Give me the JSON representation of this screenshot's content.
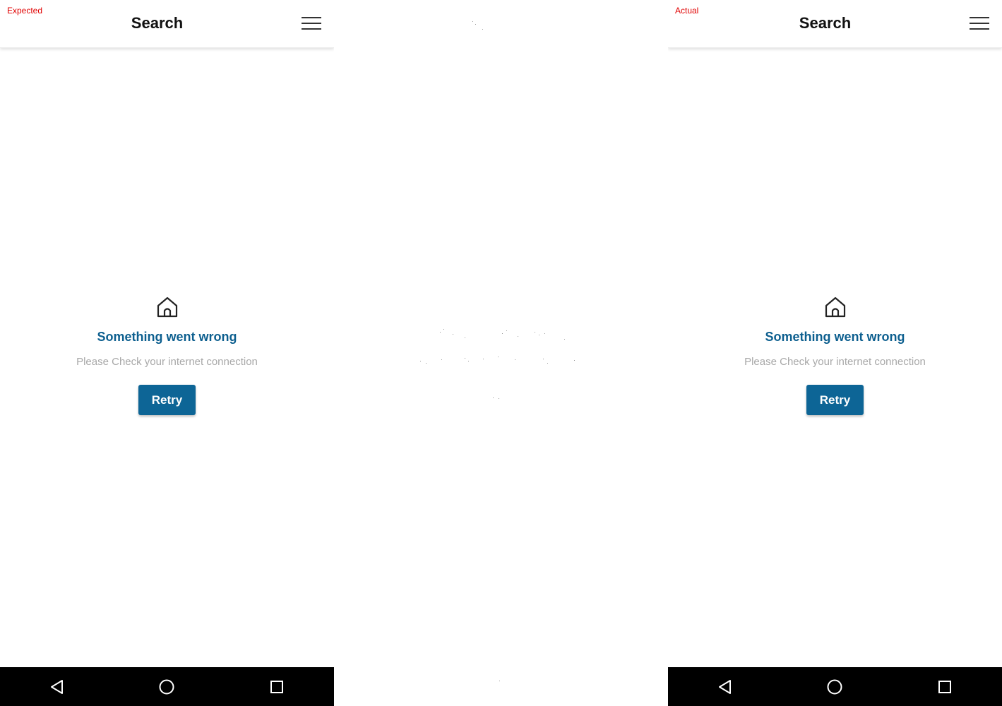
{
  "panels": {
    "expected": {
      "tag": "Expected",
      "app_bar": {
        "title": "Search",
        "menu_icon": "hamburger-menu-icon"
      },
      "error": {
        "icon": "home-icon",
        "title": "Something went wrong",
        "message": "Please Check your internet connection",
        "retry_label": "Retry"
      },
      "nav_bar": {
        "icons": [
          "back-icon",
          "home-circle-icon",
          "recents-icon"
        ]
      }
    },
    "actual": {
      "tag": "Actual",
      "app_bar": {
        "title": "Search",
        "menu_icon": "hamburger-menu-icon"
      },
      "error": {
        "icon": "home-icon",
        "title": "Something went wrong",
        "message": "Please Check your internet connection",
        "retry_label": "Retry"
      },
      "nav_bar": {
        "icons": [
          "back-icon",
          "home-circle-icon",
          "recents-icon"
        ]
      }
    }
  },
  "colors": {
    "accent": "#0d6596",
    "error_title": "#0d5f8f",
    "tag": "#e00000",
    "nav_bar": "#000000"
  }
}
